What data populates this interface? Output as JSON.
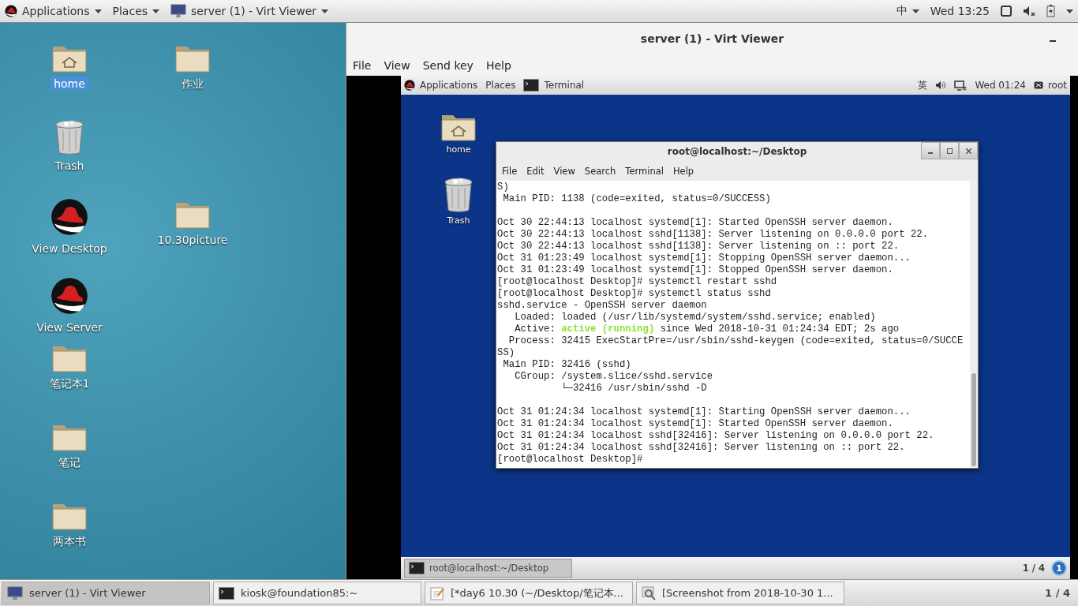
{
  "top_bar": {
    "menus": [
      {
        "label": "Applications",
        "kind": "logo"
      },
      {
        "label": "Places",
        "kind": "plain"
      }
    ],
    "window_button": {
      "label": "server (1) - Virt Viewer"
    },
    "input_method": "中",
    "clock": "Wed 13:25"
  },
  "desktop": {
    "icons": [
      {
        "label": "home",
        "kind": "home",
        "selected": true
      },
      {
        "label": "Trash",
        "kind": "trash",
        "selected": false
      },
      {
        "label": "View Desktop",
        "kind": "redhat",
        "selected": false
      },
      {
        "label": "View Server",
        "kind": "redhat",
        "selected": false
      },
      {
        "label": "笔记本1",
        "kind": "folder",
        "selected": false
      },
      {
        "label": "笔记",
        "kind": "folder",
        "selected": false
      },
      {
        "label": "两本书",
        "kind": "folder",
        "selected": false
      },
      {
        "label": "作业",
        "kind": "folder",
        "selected": false
      },
      {
        "label": "10.30picture",
        "kind": "folder",
        "selected": false
      }
    ]
  },
  "viewer": {
    "title": "server (1) - Virt Viewer",
    "menu": [
      "File",
      "View",
      "Send key",
      "Help"
    ],
    "guest": {
      "top_bar": {
        "menus": [
          "Applications",
          "Places"
        ],
        "window_button": "Terminal",
        "input_method": "英",
        "clock": "Wed 01:24",
        "user": "root"
      },
      "icons": [
        {
          "label": "home",
          "kind": "home"
        },
        {
          "label": "Trash",
          "kind": "trash"
        }
      ],
      "terminal": {
        "title": "root@localhost:~/Desktop",
        "menu": [
          "File",
          "Edit",
          "View",
          "Search",
          "Terminal",
          "Help"
        ],
        "lines": [
          {
            "kind": "text",
            "text": "S)"
          },
          {
            "kind": "text",
            "text": " Main PID: 1138 (code=exited, status=0/SUCCESS)"
          },
          {
            "kind": "blank"
          },
          {
            "kind": "text",
            "text": "Oct 30 22:44:13 localhost systemd[1]: Started OpenSSH server daemon."
          },
          {
            "kind": "text",
            "text": "Oct 30 22:44:13 localhost sshd[1138]: Server listening on 0.0.0.0 port 22."
          },
          {
            "kind": "text",
            "text": "Oct 30 22:44:13 localhost sshd[1138]: Server listening on :: port 22."
          },
          {
            "kind": "text",
            "text": "Oct 31 01:23:49 localhost systemd[1]: Stopping OpenSSH server daemon..."
          },
          {
            "kind": "text",
            "text": "Oct 31 01:23:49 localhost systemd[1]: Stopped OpenSSH server daemon."
          },
          {
            "kind": "text",
            "text": "[root@localhost Desktop]# systemctl restart sshd"
          },
          {
            "kind": "text",
            "text": "[root@localhost Desktop]# systemctl status sshd"
          },
          {
            "kind": "text",
            "text": "sshd.service - OpenSSH server daemon"
          },
          {
            "kind": "text",
            "text": "   Loaded: loaded (/usr/lib/systemd/system/sshd.service; enabled)"
          },
          {
            "kind": "status",
            "before": "   Active: ",
            "active": "active (running)",
            "after": " since Wed 2018-10-31 01:24:34 EDT; 2s ago"
          },
          {
            "kind": "text",
            "text": "  Process: 32415 ExecStartPre=/usr/sbin/sshd-keygen (code=exited, status=0/SUCCE"
          },
          {
            "kind": "text",
            "text": "SS)"
          },
          {
            "kind": "text",
            "text": " Main PID: 32416 (sshd)"
          },
          {
            "kind": "text",
            "text": "   CGroup: /system.slice/sshd.service"
          },
          {
            "kind": "text",
            "text": "           └─32416 /usr/sbin/sshd -D"
          },
          {
            "kind": "blank"
          },
          {
            "kind": "text",
            "text": "Oct 31 01:24:34 localhost systemd[1]: Starting OpenSSH server daemon..."
          },
          {
            "kind": "text",
            "text": "Oct 31 01:24:34 localhost systemd[1]: Started OpenSSH server daemon."
          },
          {
            "kind": "text",
            "text": "Oct 31 01:24:34 localhost sshd[32416]: Server listening on 0.0.0.0 port 22."
          },
          {
            "kind": "text",
            "text": "Oct 31 01:24:34 localhost sshd[32416]: Server listening on :: port 22."
          },
          {
            "kind": "text",
            "text": "[root@localhost Desktop]#"
          }
        ]
      },
      "taskbar": {
        "items": [
          {
            "label": "root@localhost:~/Desktop",
            "selected": true
          }
        ],
        "pager": "1 / 4",
        "notifications": "1"
      }
    }
  },
  "taskbar": {
    "items": [
      {
        "label": "server (1) - Virt Viewer",
        "kind": "monitor",
        "selected": true
      },
      {
        "label": "kiosk@foundation85:~",
        "kind": "terminal",
        "selected": false
      },
      {
        "label": "[*day6 10.30 (~/Desktop/笔记本...",
        "kind": "editor",
        "selected": false
      },
      {
        "label": "[Screenshot from 2018-10-30 1...",
        "kind": "screenshot",
        "selected": false
      }
    ],
    "pager": "1 / 4"
  }
}
